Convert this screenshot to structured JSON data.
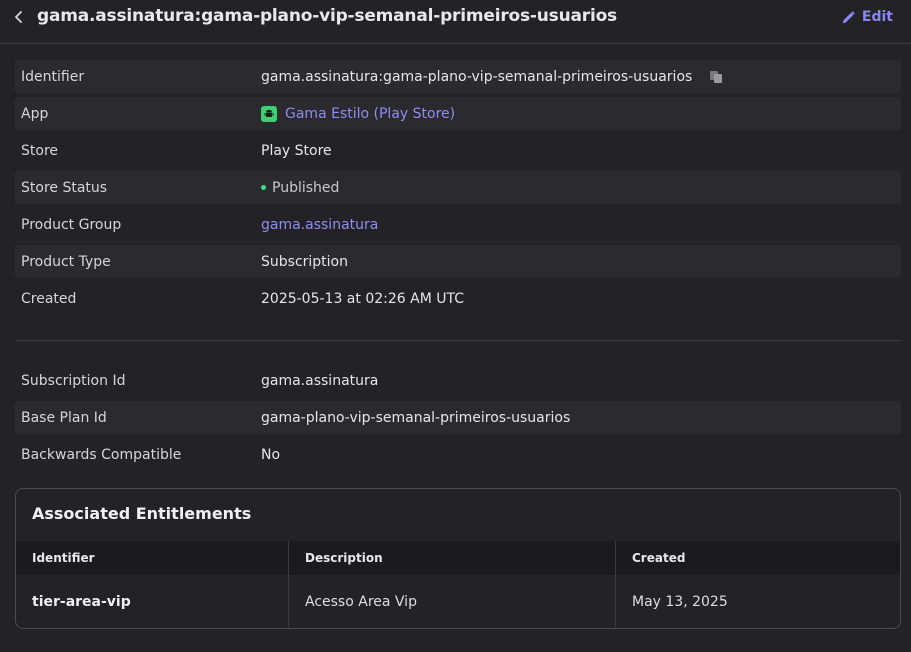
{
  "header": {
    "title": "gama.assinatura:gama-plano-vip-semanal-primeiros-usuarios",
    "edit_label": "Edit"
  },
  "details": [
    {
      "label": "Identifier",
      "value": "gama.assinatura:gama-plano-vip-semanal-primeiros-usuarios"
    },
    {
      "label": "App",
      "value": "Gama Estilo (Play Store)"
    },
    {
      "label": "Store",
      "value": "Play Store"
    },
    {
      "label": "Store Status",
      "value": "Published"
    },
    {
      "label": "Product Group",
      "value": "gama.assinatura"
    },
    {
      "label": "Product Type",
      "value": "Subscription"
    },
    {
      "label": "Created",
      "value": "2025-05-13 at 02:26 AM UTC"
    }
  ],
  "subscription": [
    {
      "label": "Subscription Id",
      "value": "gama.assinatura"
    },
    {
      "label": "Base Plan Id",
      "value": "gama-plano-vip-semanal-primeiros-usuarios"
    },
    {
      "label": "Backwards Compatible",
      "value": "No"
    }
  ],
  "entitlements": {
    "title": "Associated Entitlements",
    "columns": [
      "Identifier",
      "Description",
      "Created"
    ],
    "rows": [
      {
        "identifier": "tier-area-vip",
        "description": "Acesso Area Vip",
        "created": "May 13, 2025"
      }
    ]
  },
  "colors": {
    "accent": "#8a86f0",
    "status_published": "#3ddc84",
    "android": "#3ecf6e"
  }
}
